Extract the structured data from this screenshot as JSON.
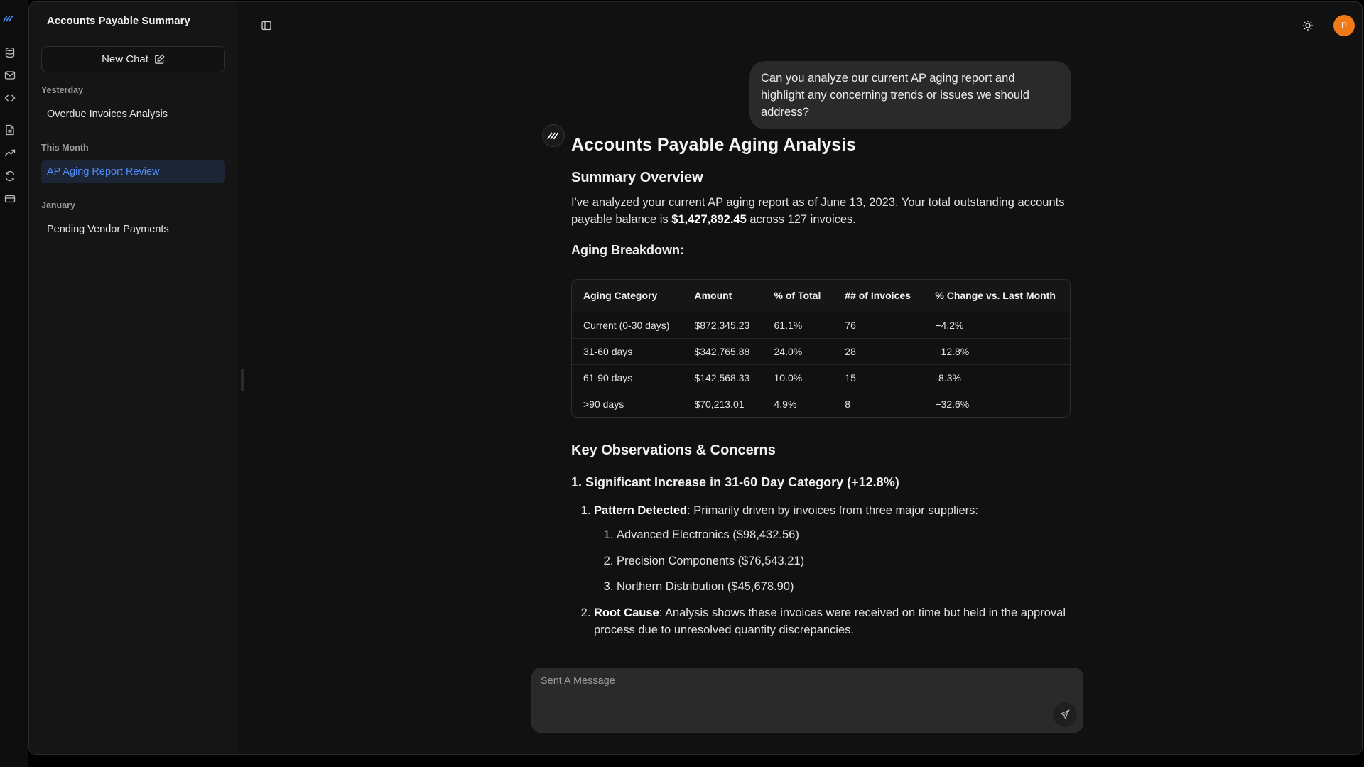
{
  "sidebar": {
    "title": "Accounts Payable Summary",
    "new_chat_label": "New Chat",
    "groups": [
      {
        "label": "Yesterday",
        "items": [
          {
            "label": "Overdue Invoices Analysis",
            "active": false
          }
        ]
      },
      {
        "label": "This Month",
        "items": [
          {
            "label": "AP Aging Report Review",
            "active": true
          }
        ]
      },
      {
        "label": "January",
        "items": [
          {
            "label": "Pending Vendor Payments",
            "active": false
          }
        ]
      }
    ]
  },
  "rail_icons": [
    "logo-icon",
    "database-icon",
    "mail-icon",
    "code-icon",
    "document-icon",
    "trending-up-icon",
    "refresh-icon",
    "credit-card-icon"
  ],
  "header": {
    "avatar_initial": "P"
  },
  "user_message": "Can you analyze our current AP aging report and highlight any concerning trends or issues we should address?",
  "answer": {
    "title": "Accounts Payable Aging Analysis",
    "summary_heading": "Summary Overview",
    "summary_text_1": "I've analyzed your current AP aging report as of June 13, 2023. Your total outstanding accounts payable balance is ",
    "summary_total": "$1,427,892.45",
    "summary_text_2": " across 127 invoices.",
    "breakdown_heading": "Aging Breakdown:",
    "table": {
      "headers": [
        "Aging Category",
        "Amount",
        "% of Total",
        "## of Invoices",
        "% Change vs. Last Month"
      ],
      "rows": [
        [
          "Current (0-30 days)",
          "$872,345.23",
          "61.1%",
          "76",
          "+4.2%"
        ],
        [
          "31-60 days",
          "$342,765.88",
          "24.0%",
          "28",
          "+12.8%"
        ],
        [
          "61-90 days",
          "$142,568.33",
          "10.0%",
          "15",
          "-8.3%"
        ],
        [
          ">90 days",
          "$70,213.01",
          "4.9%",
          "8",
          "+32.6%"
        ]
      ]
    },
    "observations_heading": "Key Observations & Concerns",
    "obs1_heading": "1. Significant Increase in 31-60 Day Category (+12.8%)",
    "obs1_items": [
      {
        "bold": "Pattern Detected",
        "text": ": Primarily driven by invoices from three major suppliers:",
        "subitems": [
          "Advanced Electronics ($98,432.56)",
          "Precision Components ($76,543.21)",
          "Northern Distribution ($45,678.90)"
        ]
      },
      {
        "bold": "Root Cause",
        "text": ": Analysis shows these invoices were received on time but held in the approval process due to unresolved quantity discrepancies."
      }
    ]
  },
  "composer": {
    "placeholder": "Sent A Message"
  },
  "colors": {
    "accent": "#4f8ef7",
    "avatar": "#f07a19",
    "background": "#111111"
  }
}
